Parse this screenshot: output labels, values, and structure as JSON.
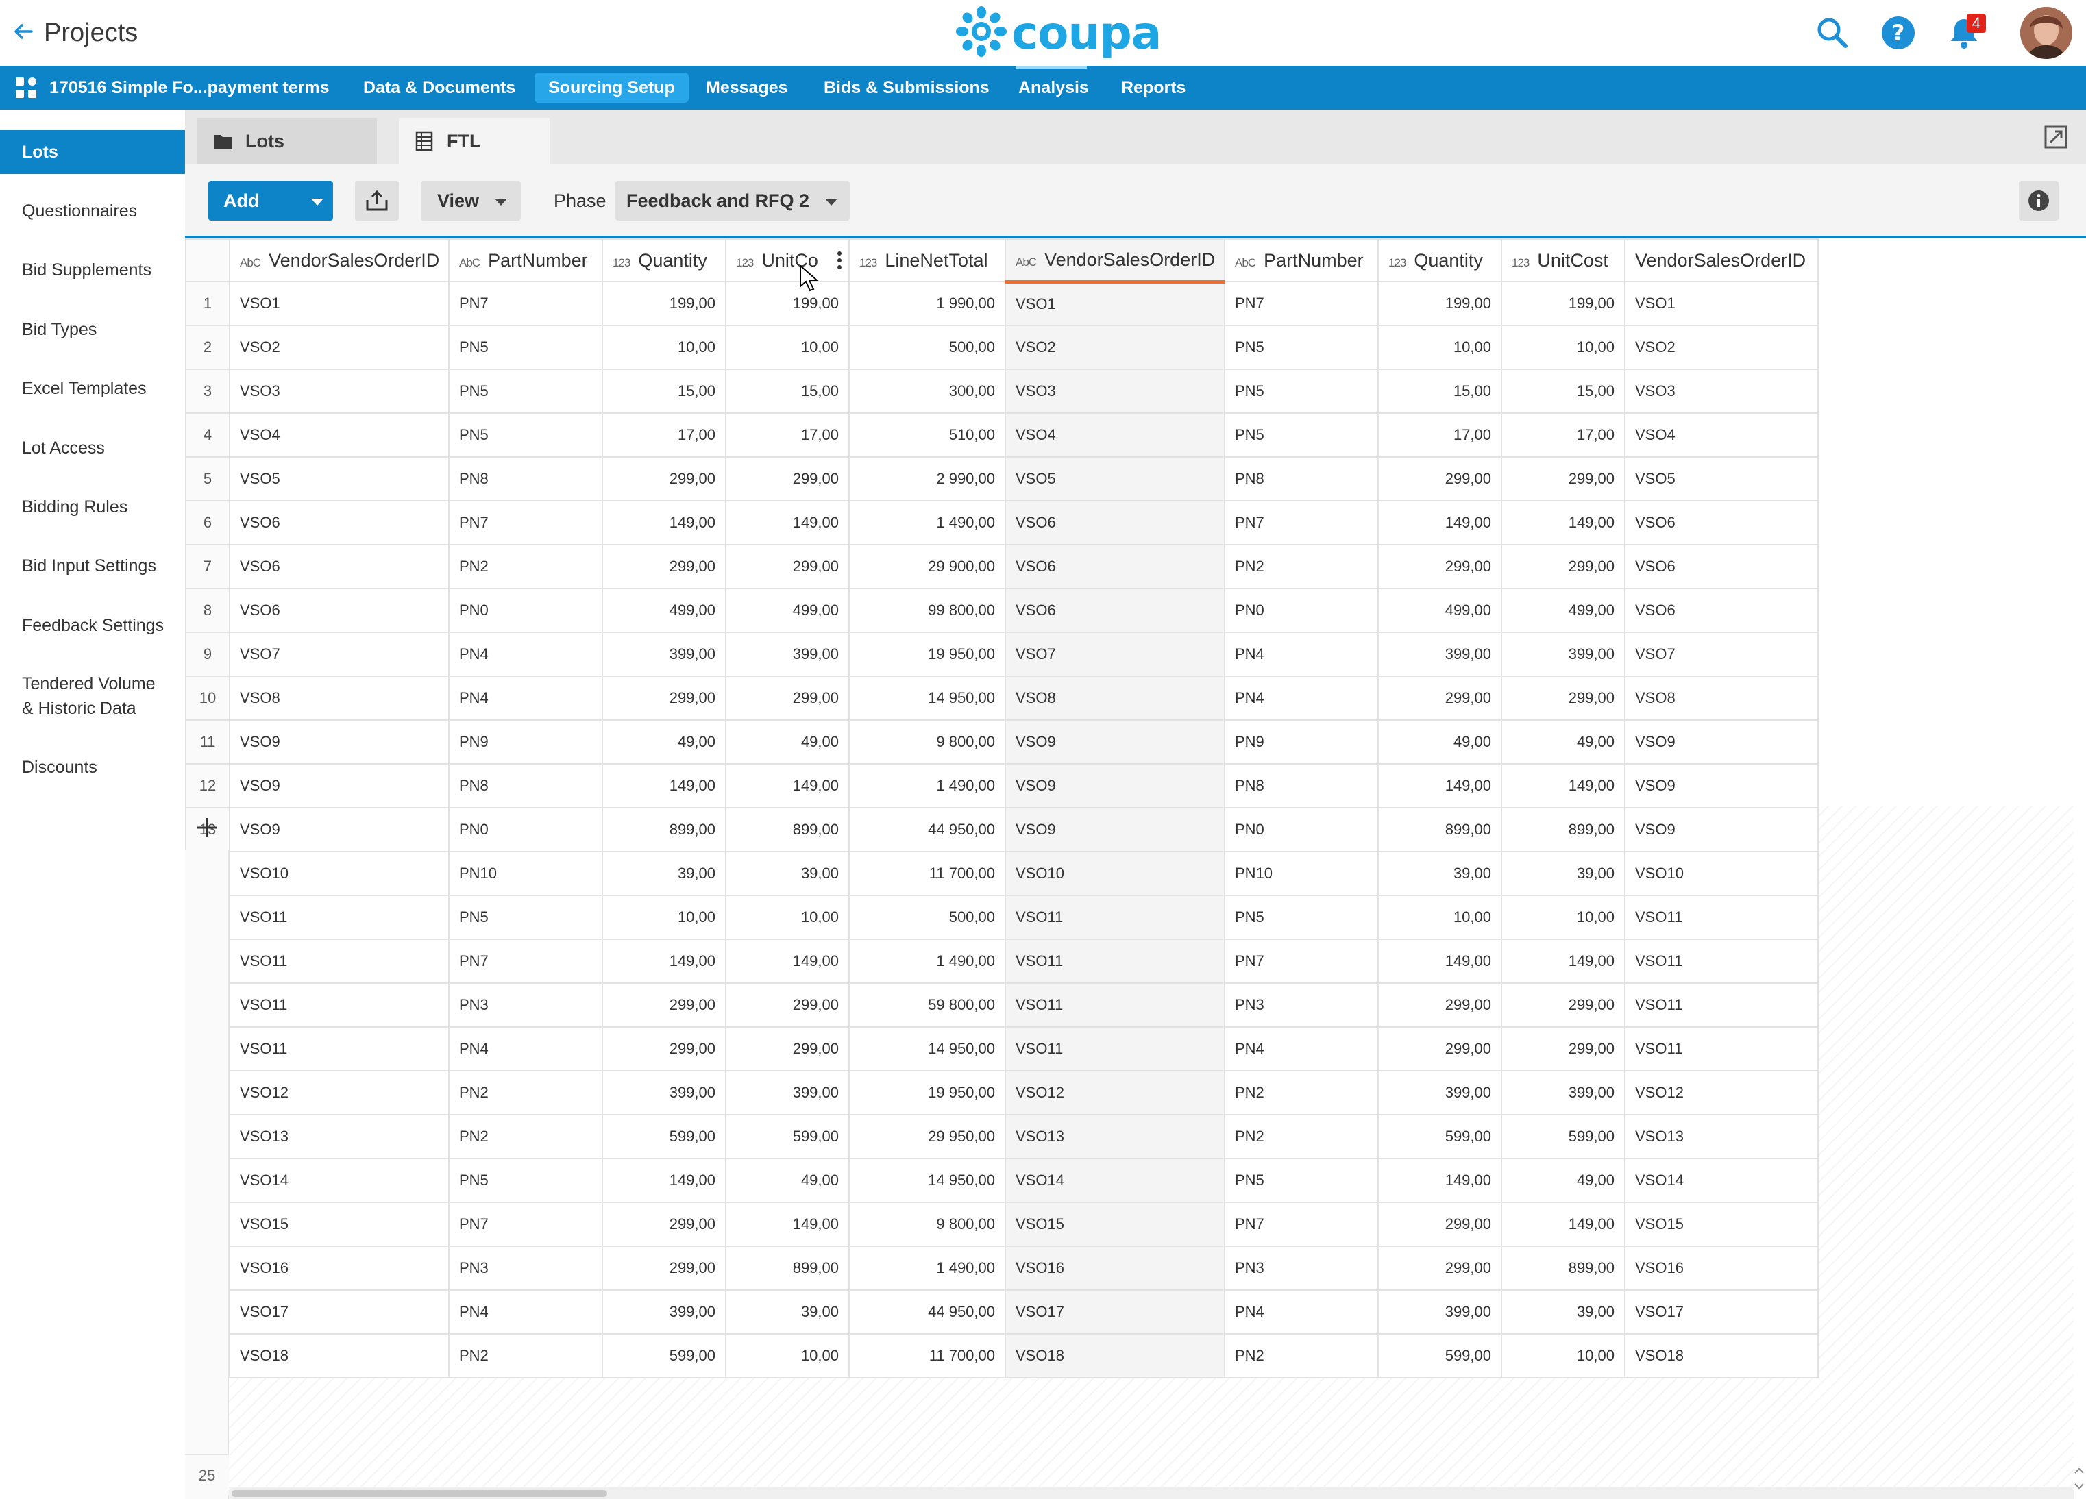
{
  "header": {
    "back_label": "Projects",
    "logo_text": "coupa",
    "notification_count": "4",
    "brand_color": "#1da6e3",
    "icons": [
      "arrow-left-icon",
      "search-icon",
      "help-icon",
      "bell-icon"
    ]
  },
  "nav": {
    "project_name": "170516 Simple Fo...payment terms",
    "items": [
      {
        "label": "Data & Documents"
      },
      {
        "label": "Sourcing Setup"
      },
      {
        "label": "Messages"
      },
      {
        "label": "Bids & Submissions"
      },
      {
        "label": "Analysis"
      },
      {
        "label": "Reports"
      }
    ],
    "active": "Sourcing Setup",
    "bar_color": "#0d84c7"
  },
  "sidebar": {
    "items": [
      {
        "label": "Lots"
      },
      {
        "label": "Questionnaires"
      },
      {
        "label": "Bid Supplements"
      },
      {
        "label": "Bid Types"
      },
      {
        "label": "Excel Templates"
      },
      {
        "label": "Lot Access"
      },
      {
        "label": "Bidding Rules"
      },
      {
        "label": "Bid Input Settings"
      },
      {
        "label": "Feedback Settings"
      },
      {
        "label": "Tendered Volume & Historic Data"
      },
      {
        "label": "Discounts"
      }
    ],
    "active": "Lots"
  },
  "tabs": [
    {
      "label": "Lots",
      "icon": "folder-icon"
    },
    {
      "label": "FTL",
      "icon": "spreadsheet-icon"
    }
  ],
  "toolbar": {
    "add_label": "Add",
    "view_label": "View",
    "phase_label": "Phase",
    "phase_value": "Feedback and RFQ 2"
  },
  "grid": {
    "columns": [
      {
        "name": "VendorSalesOrderID",
        "type": "text",
        "type_icon": "AbC"
      },
      {
        "name": "PartNumber",
        "type": "text",
        "type_icon": "AbC"
      },
      {
        "name": "Quantity",
        "type": "number",
        "type_icon": "123"
      },
      {
        "name": "UnitCo",
        "type": "number",
        "type_icon": "123"
      },
      {
        "name": "LineNetTotal",
        "type": "number",
        "type_icon": "123"
      },
      {
        "name": "VendorSalesOrderID",
        "type": "text",
        "type_icon": "AbC"
      },
      {
        "name": "PartNumber",
        "type": "text",
        "type_icon": "AbC"
      },
      {
        "name": "Quantity",
        "type": "number",
        "type_icon": "123"
      },
      {
        "name": "UnitCost",
        "type": "number",
        "type_icon": "123"
      },
      {
        "name": "VendorSalesOrderID",
        "type": "text",
        "type_icon": ""
      }
    ],
    "selected_column": 5,
    "rows": [
      [
        "VSO1",
        "PN7",
        "199,00",
        "199,00",
        "1 990,00",
        "VSO1",
        "PN7",
        "199,00",
        "199,00",
        "VSO1"
      ],
      [
        "VSO2",
        "PN5",
        "10,00",
        "10,00",
        "500,00",
        "VSO2",
        "PN5",
        "10,00",
        "10,00",
        "VSO2"
      ],
      [
        "VSO3",
        "PN5",
        "15,00",
        "15,00",
        "300,00",
        "VSO3",
        "PN5",
        "15,00",
        "15,00",
        "VSO3"
      ],
      [
        "VSO4",
        "PN5",
        "17,00",
        "17,00",
        "510,00",
        "VSO4",
        "PN5",
        "17,00",
        "17,00",
        "VSO4"
      ],
      [
        "VSO5",
        "PN8",
        "299,00",
        "299,00",
        "2 990,00",
        "VSO5",
        "PN8",
        "299,00",
        "299,00",
        "VSO5"
      ],
      [
        "VSO6",
        "PN7",
        "149,00",
        "149,00",
        "1 490,00",
        "VSO6",
        "PN7",
        "149,00",
        "149,00",
        "VSO6"
      ],
      [
        "VSO6",
        "PN2",
        "299,00",
        "299,00",
        "29 900,00",
        "VSO6",
        "PN2",
        "299,00",
        "299,00",
        "VSO6"
      ],
      [
        "VSO6",
        "PN0",
        "499,00",
        "499,00",
        "99 800,00",
        "VSO6",
        "PN0",
        "499,00",
        "499,00",
        "VSO6"
      ],
      [
        "VSO7",
        "PN4",
        "399,00",
        "399,00",
        "19 950,00",
        "VSO7",
        "PN4",
        "399,00",
        "399,00",
        "VSO7"
      ],
      [
        "VSO8",
        "PN4",
        "299,00",
        "299,00",
        "14 950,00",
        "VSO8",
        "PN4",
        "299,00",
        "299,00",
        "VSO8"
      ],
      [
        "VSO9",
        "PN9",
        "49,00",
        "49,00",
        "9 800,00",
        "VSO9",
        "PN9",
        "49,00",
        "49,00",
        "VSO9"
      ],
      [
        "VSO9",
        "PN8",
        "149,00",
        "149,00",
        "1 490,00",
        "VSO9",
        "PN8",
        "149,00",
        "149,00",
        "VSO9"
      ],
      [
        "VSO9",
        "PN0",
        "899,00",
        "899,00",
        "44 950,00",
        "VSO9",
        "PN0",
        "899,00",
        "899,00",
        "VSO9"
      ],
      [
        "VSO10",
        "PN10",
        "39,00",
        "39,00",
        "11 700,00",
        "VSO10",
        "PN10",
        "39,00",
        "39,00",
        "VSO10"
      ],
      [
        "VSO11",
        "PN5",
        "10,00",
        "10,00",
        "500,00",
        "VSO11",
        "PN5",
        "10,00",
        "10,00",
        "VSO11"
      ],
      [
        "VSO11",
        "PN7",
        "149,00",
        "149,00",
        "1 490,00",
        "VSO11",
        "PN7",
        "149,00",
        "149,00",
        "VSO11"
      ],
      [
        "VSO11",
        "PN3",
        "299,00",
        "299,00",
        "59 800,00",
        "VSO11",
        "PN3",
        "299,00",
        "299,00",
        "VSO11"
      ],
      [
        "VSO11",
        "PN4",
        "299,00",
        "299,00",
        "14 950,00",
        "VSO11",
        "PN4",
        "299,00",
        "299,00",
        "VSO11"
      ],
      [
        "VSO12",
        "PN2",
        "399,00",
        "399,00",
        "19 950,00",
        "VSO12",
        "PN2",
        "399,00",
        "399,00",
        "VSO12"
      ],
      [
        "VSO13",
        "PN2",
        "599,00",
        "599,00",
        "29 950,00",
        "VSO13",
        "PN2",
        "599,00",
        "599,00",
        "VSO13"
      ],
      [
        "VSO14",
        "PN5",
        "149,00",
        "49,00",
        "14 950,00",
        "VSO14",
        "PN5",
        "149,00",
        "49,00",
        "VSO14"
      ],
      [
        "VSO15",
        "PN7",
        "299,00",
        "149,00",
        "9 800,00",
        "VSO15",
        "PN7",
        "299,00",
        "149,00",
        "VSO15"
      ],
      [
        "VSO16",
        "PN3",
        "299,00",
        "899,00",
        "1 490,00",
        "VSO16",
        "PN3",
        "299,00",
        "899,00",
        "VSO16"
      ],
      [
        "VSO17",
        "PN4",
        "399,00",
        "39,00",
        "44 950,00",
        "VSO17",
        "PN4",
        "399,00",
        "39,00",
        "VSO17"
      ],
      [
        "VSO18",
        "PN2",
        "599,00",
        "10,00",
        "11 700,00",
        "VSO18",
        "PN2",
        "599,00",
        "10,00",
        "VSO18"
      ]
    ],
    "row_count": "25"
  }
}
